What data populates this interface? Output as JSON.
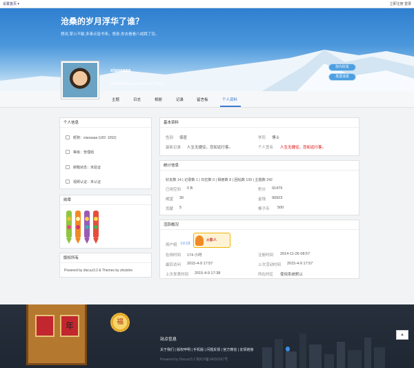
{
  "topbar": {
    "left": "设置首页 ▾",
    "right": "立即注册 登录"
  },
  "hero": {
    "title": "沧桑的岁月浮华了谁？",
    "motto": "想说,掌火不敏,多事点皆书来。想身,你去看看八成跳了没。",
    "username": "xiaoaaaa",
    "url": "http://www.dazhe.com/?1092",
    "add_friend": "加为好友",
    "send_message": "发送消息"
  },
  "nav": {
    "items": [
      "主题",
      "日志",
      "相册",
      "记录",
      "留言板",
      "个人资料"
    ],
    "active_index": 5
  },
  "left": {
    "info_title": "个人信息",
    "info_items": [
      {
        "icon": "user-icon",
        "text": "昵称：xiaoaaaa (UID: 1092)"
      },
      {
        "icon": "level-icon",
        "text": "等级：管理组"
      },
      {
        "icon": "mail-icon",
        "text": "邮箱状态：未验证"
      },
      {
        "icon": "video-icon",
        "text": "视频认证：未认证"
      }
    ],
    "medal_title": "勋章",
    "copyright_title": "版权所有",
    "copyright_text": "Powered by discuz3.2 & Themes by zhizishe"
  },
  "basic": {
    "title": "基本资料",
    "gender_label": "性别",
    "gender_value": "保密",
    "education_label": "学历",
    "education_value": "博士",
    "recent_label": "最新记录",
    "recent_value": "人生无捷径，忽如远行客。",
    "sign_label": "个人签名",
    "sign_value": "人生无捷径，忽如远行客。"
  },
  "stats": {
    "title": "统计信息",
    "counts": "好友数 14  |  记录数 1  |  日志数 0  |  相册数 8  |  回帖数 139  |  主题数 242",
    "space_label": "已用空间",
    "space_value": "0 B",
    "points_label": "积分",
    "points_value": "91479",
    "prestige_label": "威望",
    "prestige_value": "30",
    "money_label": "金钱",
    "money_value": "90923",
    "contrib_label": "贡献",
    "contrib_value": "5",
    "coin_label": "棒子币",
    "coin_value": "500"
  },
  "activity": {
    "title": "活跃概况",
    "group_label": "用户组",
    "group_value": "LV.13",
    "badge_text": "火影人",
    "online_label": "在线时间",
    "online_value": "174 小时",
    "register_label": "注册时间",
    "register_value": "2014-11-26 08:57",
    "last_visit_label": "最后访问",
    "last_visit_value": "2015-4-9 17:57",
    "last_active_label": "上次活动时间",
    "last_active_value": "2015-4-9 17:57",
    "last_post_label": "上次发表时间",
    "last_post_value": "2015-4-9 17:38",
    "timezone_label": "所在时区",
    "timezone_value": "使用系统默认"
  },
  "footer": {
    "title": "站点信息",
    "links": "关于我们 | 版权申明 | 手机版 | 问题反馈 | 官方微信 | 友情链接",
    "copyright": "Powered by Discuz!3.2 皖ICP备14059167号",
    "lantern_char": "年",
    "moon_char": "福"
  }
}
